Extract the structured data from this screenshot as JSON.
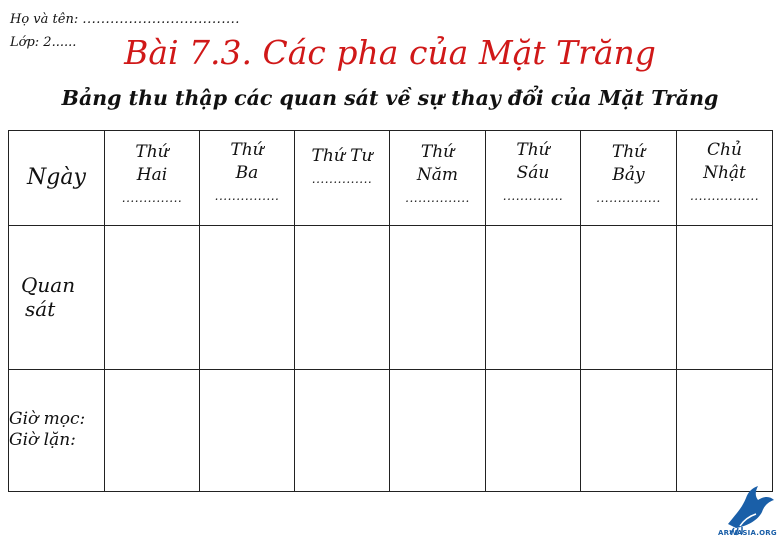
{
  "header": {
    "name_label": "Họ và tên:",
    "name_dots": "..................................",
    "class_label": "Lớp: 2......"
  },
  "title": "Bài 7.3. Các pha của Mặt Trăng",
  "subtitle": "Bảng thu thập các quan sát về sự thay đổi của Mặt Trăng",
  "table": {
    "corner_label": "Ngày",
    "days": [
      {
        "line1": "Thứ",
        "line2": "Hai",
        "dots": ".............."
      },
      {
        "line1": "Thứ",
        "line2": "Ba",
        "dots": "..............."
      },
      {
        "line1": "Thứ Tư",
        "line2": "",
        "dots": ".............."
      },
      {
        "line1": "Thứ",
        "line2": "Năm",
        "dots": "..............."
      },
      {
        "line1": "Thứ",
        "line2": "Sáu",
        "dots": ".............."
      },
      {
        "line1": "Thứ",
        "line2": "Bảy",
        "dots": "..............."
      },
      {
        "line1": "Chủ",
        "line2": "Nhật",
        "dots": "................"
      }
    ],
    "row_observation_line1": "Quan",
    "row_observation_line2": "sát",
    "row_rise_label": "Giờ mọc:",
    "row_set_label": "Giờ lặn:"
  },
  "logo": {
    "text": "ARWASIA.ORG",
    "color": "#1a5fa8"
  },
  "colors": {
    "title": "#d01818",
    "text": "#111111"
  }
}
